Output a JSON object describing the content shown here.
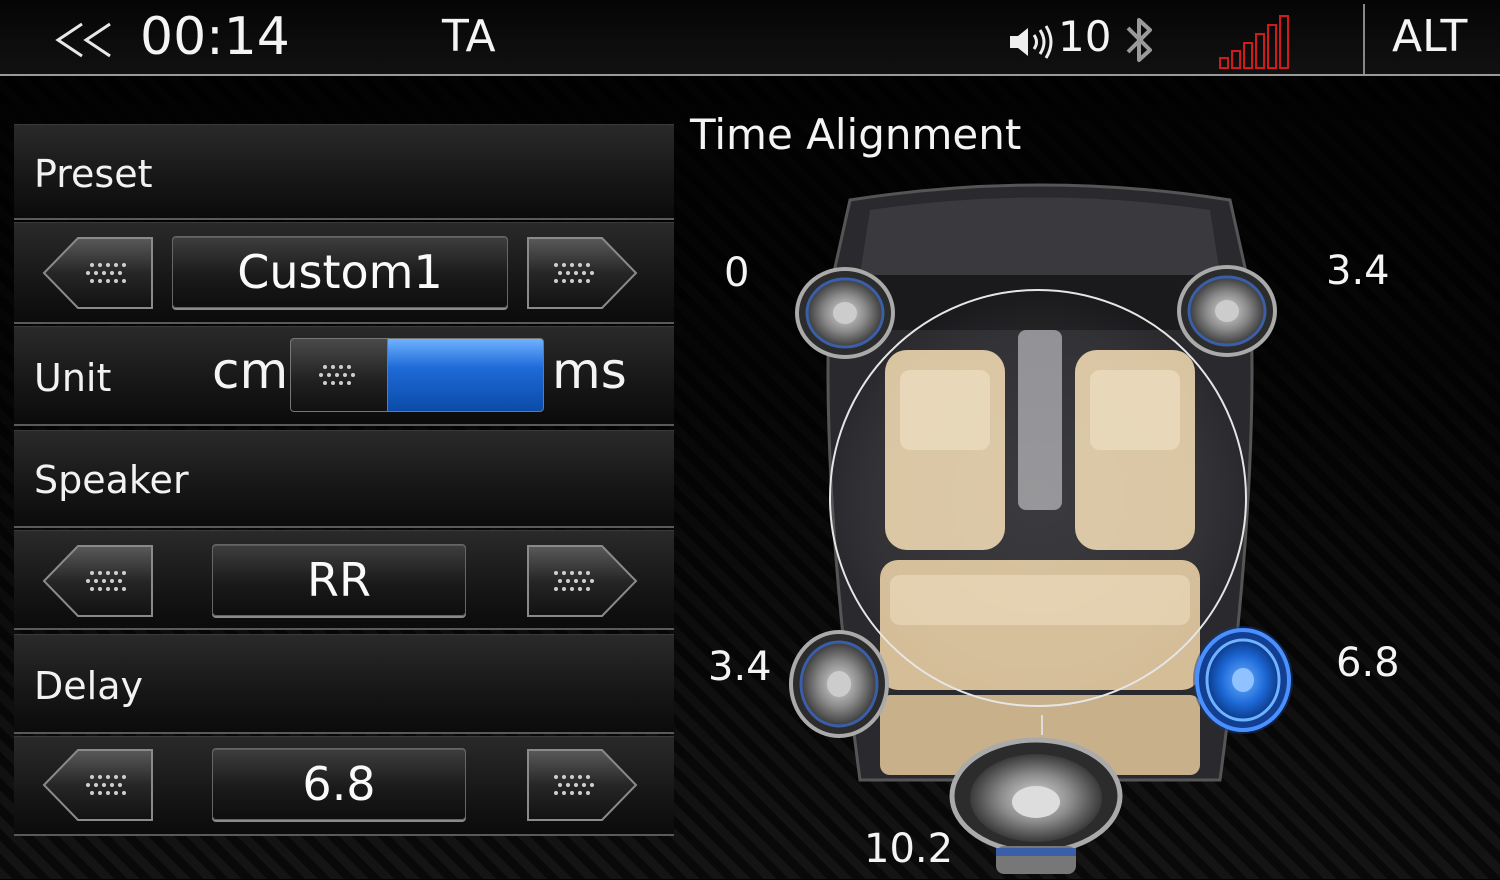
{
  "topbar": {
    "back_icon": "double-chevron-left-icon",
    "clock": "00:14",
    "title": "TA",
    "volume_icon": "speaker-volume-icon",
    "volume": "10",
    "bluetooth_icon": "bluetooth-icon",
    "signal_icon": "signal-bars-icon",
    "signal_color": "#d11a1a",
    "alt_label": "ALT"
  },
  "settings": {
    "preset": {
      "label": "Preset",
      "value": "Custom1"
    },
    "unit": {
      "label": "Unit",
      "left": "cm",
      "right": "ms",
      "selected": "ms"
    },
    "speaker": {
      "label": "Speaker",
      "value": "RR"
    },
    "delay": {
      "label": "Delay",
      "value": "6.8"
    }
  },
  "alignment": {
    "title": "Time Alignment",
    "front_left": "0",
    "front_right": "3.4",
    "rear_left": "3.4",
    "rear_right": "6.8",
    "subwoofer": "10.2",
    "selected_speaker": "RR",
    "accent_color": "#1e6ad8"
  }
}
